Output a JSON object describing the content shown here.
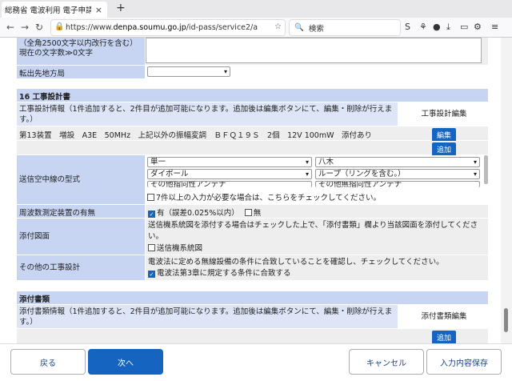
{
  "browser": {
    "tab_title": "総務省 電波利用 電子申請 · ",
    "tab_close": "×",
    "new_tab": "+",
    "url_prefix": "https://www.",
    "url_domain": "denpa.soumu.go.jp",
    "url_suffix": "/id-pass/service2/a",
    "search_placeholder": "検索"
  },
  "top": {
    "limit_note": "（全角2500文字以内改行を含む）",
    "char_count": "現在の文字数≫0文字",
    "transfer_label": "転出先地方局"
  },
  "section16": {
    "title": "16 工事設計書",
    "info_text": "工事設計情報（1件追加すると、2件目が追加可能になります。追加後は編集ボタンにて、編集・削除が行えます。）",
    "edit_header": "工事設計編集",
    "entry_line": "第13装置　増設　A3E　50MHz　上記以外の振幅変調　ＢＦＱ１９Ｓ　2個　12V 100mW　添付あり",
    "edit_button": "編集",
    "add_button": "追加",
    "antenna_label": "送信空中線の型式",
    "antenna_selects": [
      "単一",
      "八木",
      "ダイポール",
      "ループ（リングを含む。）",
      "その他指向性アンテナ",
      "その他無指向性アンテナ"
    ],
    "antenna_check": "7件以上の入力が必要な場合は、こちらをチェックしてください。",
    "freq_label": "周波数測定装置の有無",
    "freq_yes": "有（誤差0.025%以内）",
    "freq_no": "無",
    "attach_label": "添付図面",
    "attach_text": "送信機系統図を添付する場合はチェックした上で、「添付書類」欄より当該図面を添付してください。",
    "attach_check": "送信機系統図",
    "other_label": "その他の工事設計",
    "other_text": "電波法に定める無線設備の条件に合致していることを確認し、チェックしてください。",
    "other_check": "電波法第3章に規定する条件に合致する"
  },
  "attachments": {
    "title": "添付書類",
    "info_text": "添付書類情報（1件追加すると、2件目が追加可能になります。追加後は編集ボタンにて、編集・削除が行えます。）",
    "edit_header": "添付書類編集",
    "add_button": "追加"
  },
  "footer": {
    "back": "戻る",
    "next": "次へ",
    "cancel": "キャンセル",
    "save": "入力内容保存"
  }
}
